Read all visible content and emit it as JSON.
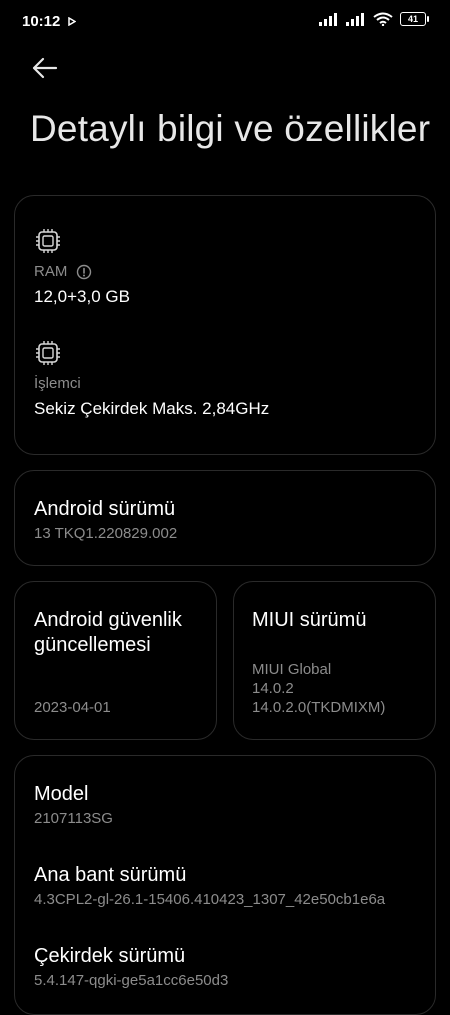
{
  "status_bar": {
    "time": "10:12",
    "battery": "41",
    "icons": [
      "play-icon",
      "signal-icon",
      "signal-icon",
      "wifi-icon",
      "battery-icon"
    ]
  },
  "header": {
    "title": "Detaylı bilgi ve özellikler"
  },
  "hardware": {
    "ram_label": "RAM",
    "ram_value": "12,0+3,0 GB",
    "cpu_label": "İşlemci",
    "cpu_value": "Sekiz Çekirdek Maks. 2,84GHz"
  },
  "android": {
    "title": "Android sürümü",
    "value": "13 TKQ1.220829.002"
  },
  "security": {
    "title_line1": "Android güvenlik",
    "title_line2": "güncellemesi",
    "value": "2023-04-01"
  },
  "miui": {
    "title": "MIUI sürümü",
    "line1": "MIUI Global",
    "line2": "14.0.2",
    "line3": "14.0.2.0(TKDMIXM)"
  },
  "device": {
    "model_title": "Model",
    "model_value": "2107113SG",
    "baseband_title": "Ana bant sürümü",
    "baseband_value": "4.3CPL2-gl-26.1-15406.410423_1307_42e50cb1e6a",
    "kernel_title": "Çekirdek sürümü",
    "kernel_value": "5.4.147-qgki-ge5a1cc6e50d3"
  }
}
